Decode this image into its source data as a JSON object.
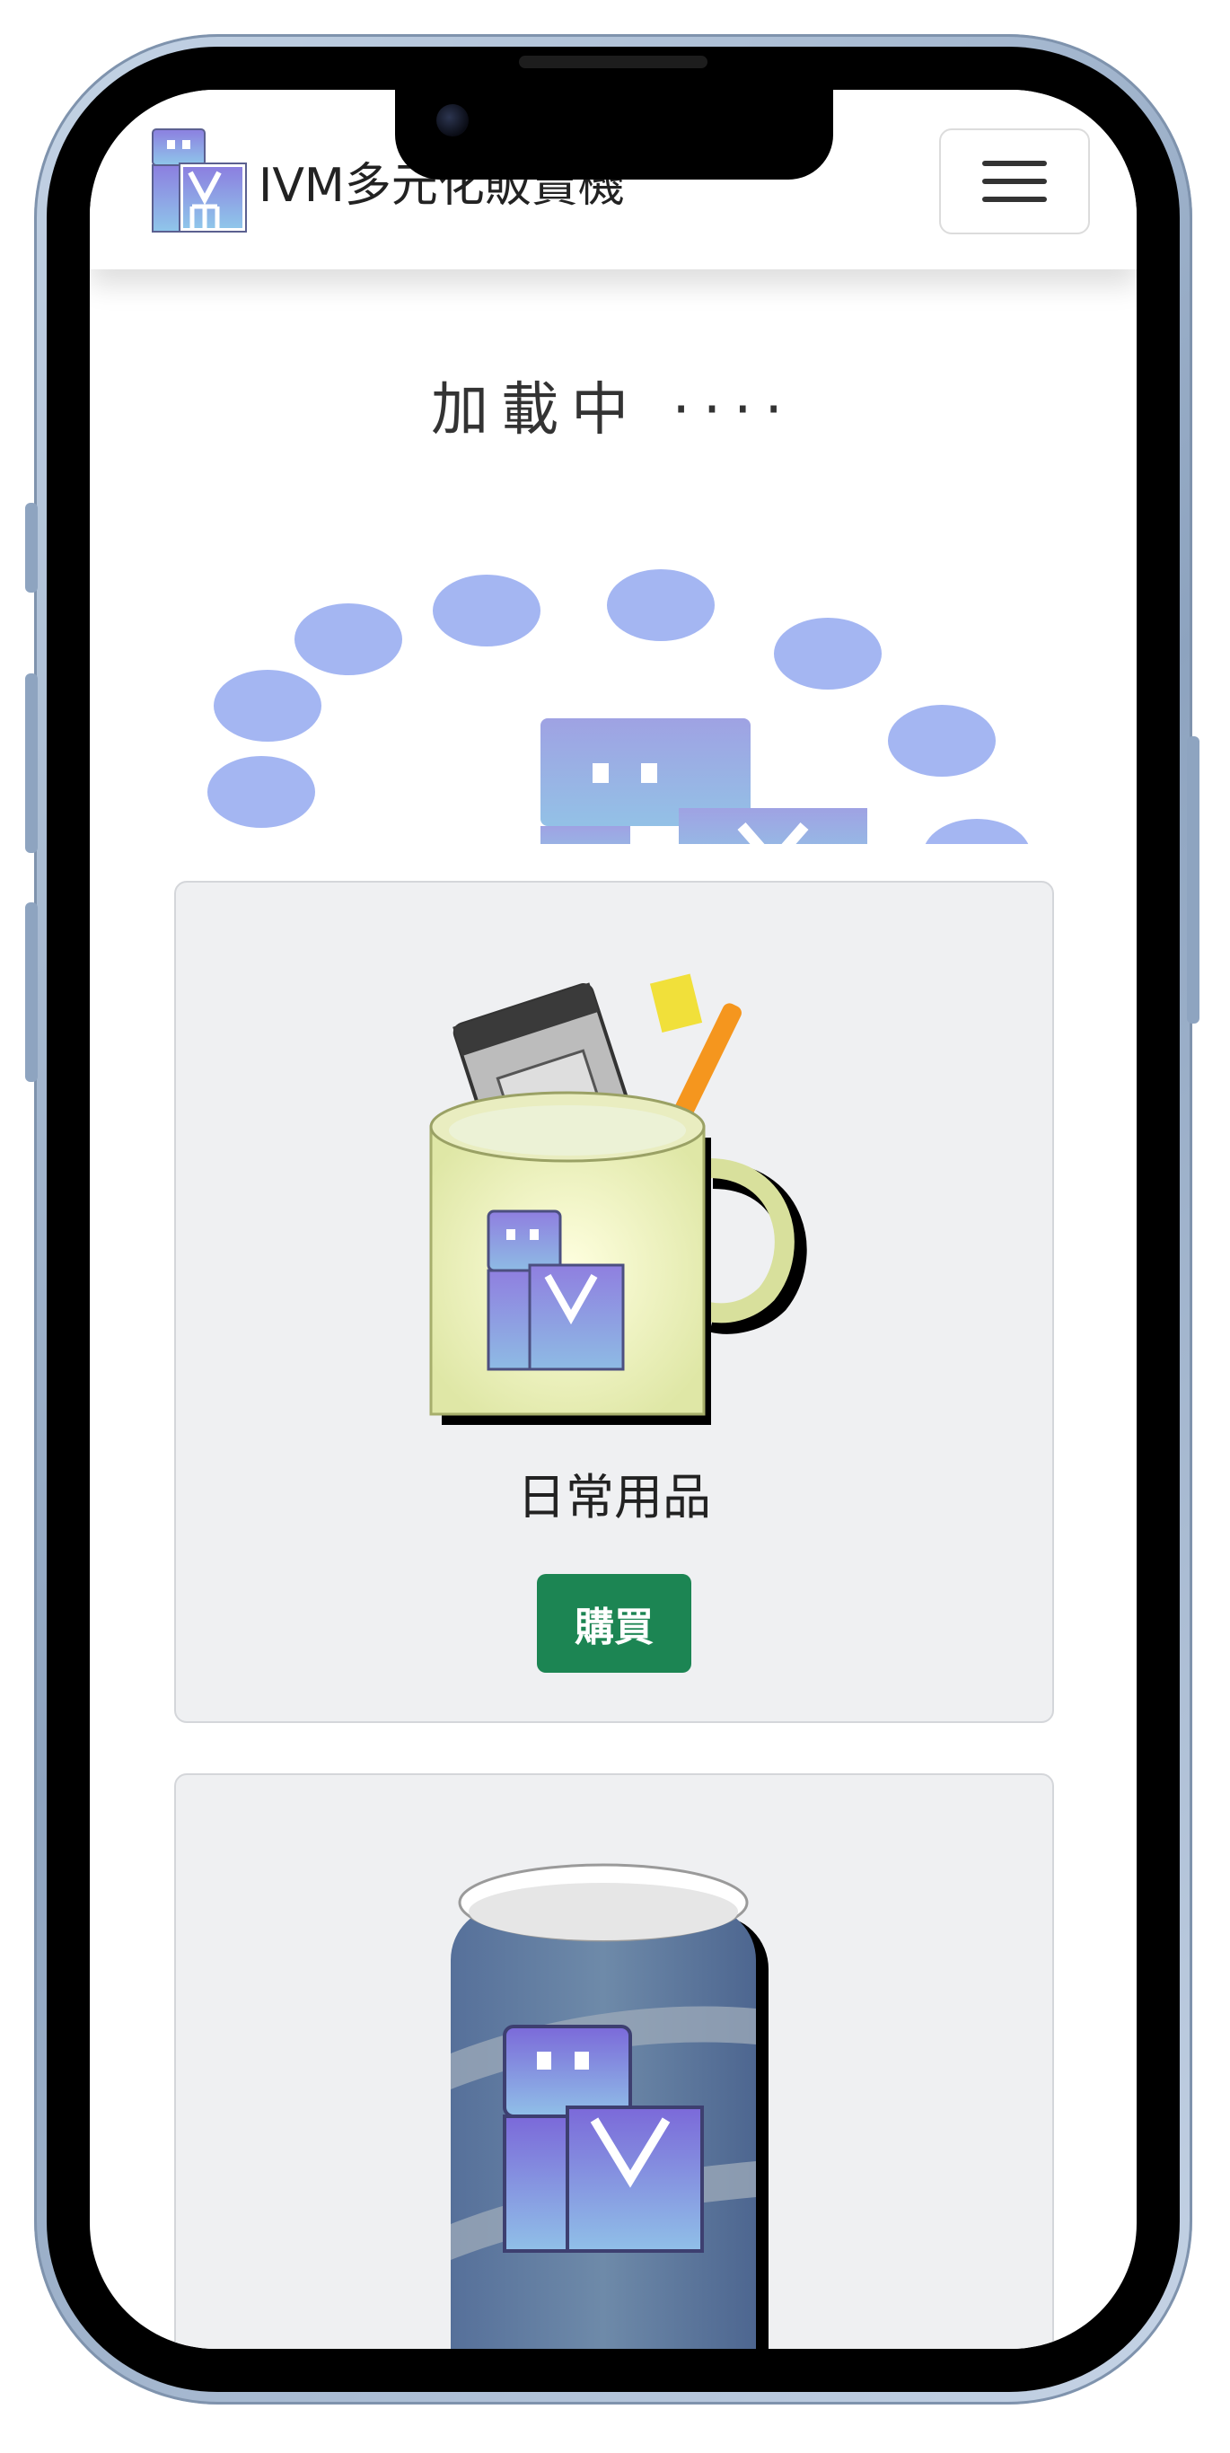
{
  "navbar": {
    "brand_text": "IVM多元化販賣機",
    "logo_icon": "ivm-logo-icon",
    "menu_icon": "hamburger-menu-icon"
  },
  "loading": {
    "text": "加載中 ····"
  },
  "products": [
    {
      "title": "日常用品",
      "button_label": "購買",
      "image_icon": "ivm-mug-icon"
    },
    {
      "title": "",
      "button_label": "",
      "image_icon": "ivm-can-icon"
    }
  ],
  "colors": {
    "buy_button": "#1c8553",
    "card_bg": "#eff0f2",
    "spinner_dots": "#a4b6f2",
    "logo_gradient_top": "#9ea3e2",
    "logo_gradient_bottom": "#93bde6"
  }
}
